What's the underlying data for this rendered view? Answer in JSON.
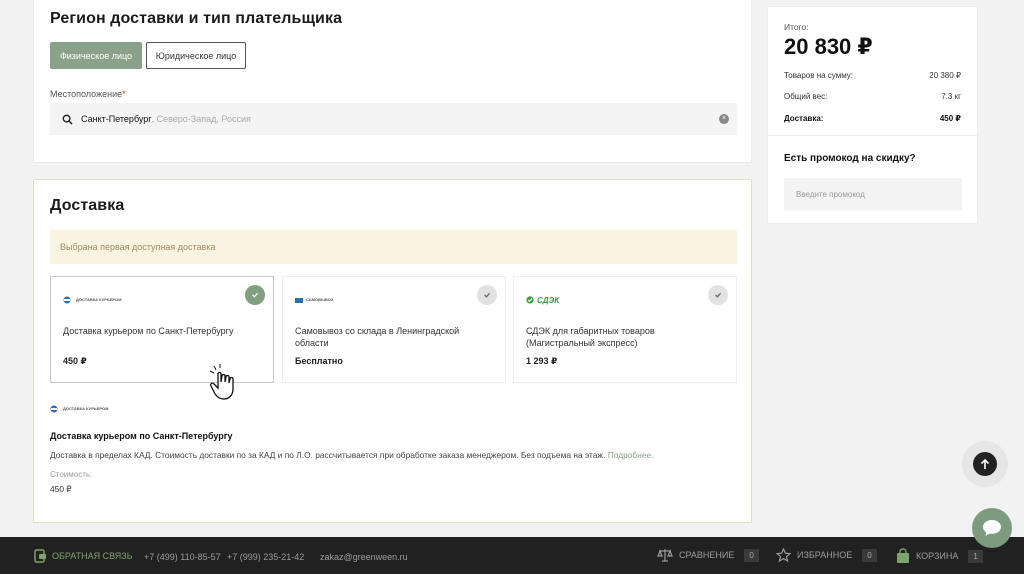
{
  "region": {
    "title": "Регион доставки и тип плательщика",
    "payer_tabs": [
      "Физическое лицо",
      "Юридическое лицо"
    ],
    "active_tab": 0,
    "location_label": "Местоположение",
    "required_mark": "*",
    "location_city": "Санкт-Петербург",
    "location_rest": ", Северо-Запад, Россия"
  },
  "delivery": {
    "title": "Доставка",
    "notice": "Выбрана первая доступная доставка",
    "options": [
      {
        "logo": "ДОСТАВКА КУРЬЕРОМ",
        "name": "Доставка курьером по Санкт-Петербургу",
        "price": "450 ₽",
        "selected": true
      },
      {
        "logo": "САМОВЫВОЗ",
        "name": "Самовывоз со склада в Ленинградской области",
        "price": "Бесплатно",
        "selected": false
      },
      {
        "logo": "СДЭК",
        "name": "СДЭК для габаритных товаров (Магистральный экспресс)",
        "price": "1 293 ₽",
        "selected": false
      }
    ],
    "detail": {
      "logo": "ДОСТАВКА КУРЬЕРОМ",
      "title": "Доставка курьером по Санкт-Петербургу",
      "description": "Доставка в пределах КАД. Стоимость доставки по за КАД и по Л.О. рассчитывается при обработке заказа менеджером. Без подъема на этаж.",
      "more_link": "Подробнее.",
      "cost_label": "Стоимость:",
      "cost_value": "450 ₽"
    }
  },
  "summary": {
    "total_label": "Итого:",
    "total_value": "20 830 ₽",
    "rows": [
      {
        "label": "Товаров на сумму:",
        "value": "20 380 ₽"
      },
      {
        "label": "Общий вес:",
        "value": "7.3 кг"
      },
      {
        "label": "Доставка:",
        "value": "450 ₽"
      }
    ],
    "promo_title": "Есть промокод на скидку?",
    "promo_placeholder": "Введите промокод"
  },
  "footer": {
    "feedback": "ОБРАТНАЯ СВЯЗЬ",
    "phone1": "+7 (499) 110-85-57",
    "phone2": "+7 (999) 235-21-42",
    "email": "zakaz@greenween.ru",
    "compare_label": "СРАВНЕНИЕ",
    "compare_count": "0",
    "favorites_label": "ИЗБРАННОЕ",
    "favorites_count": "0",
    "cart_label": "КОРЗИНА",
    "cart_count": "1"
  },
  "colors": {
    "accent_green": "#8ba28a",
    "notice_bg": "#f8f4e1",
    "footer_bg": "#212121"
  }
}
